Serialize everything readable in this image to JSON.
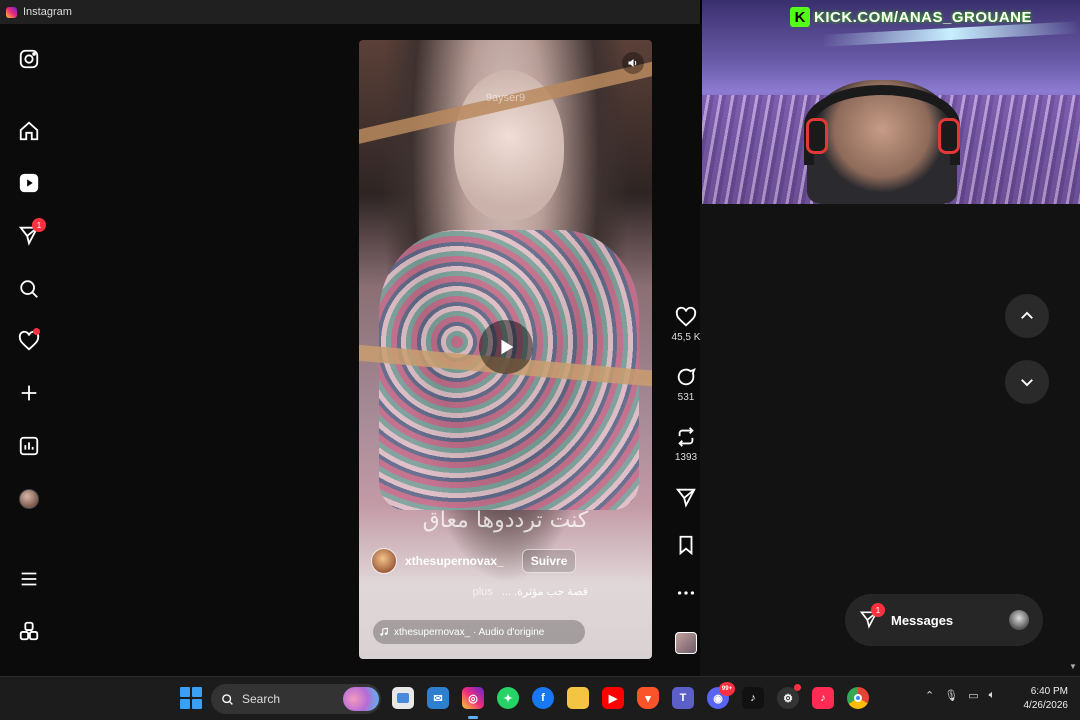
{
  "window": {
    "title": "Instagram"
  },
  "sidebar": {
    "items": [
      {
        "name": "instagram-logo",
        "icon": "instagram-icon"
      },
      {
        "name": "home",
        "icon": "home-icon"
      },
      {
        "name": "reels",
        "icon": "reels-icon"
      },
      {
        "name": "messages",
        "icon": "direct-icon",
        "badge": "1"
      },
      {
        "name": "search",
        "icon": "search-icon"
      },
      {
        "name": "notifications",
        "icon": "heart-icon"
      },
      {
        "name": "create",
        "icon": "plus-icon"
      },
      {
        "name": "dashboard",
        "icon": "chart-icon"
      },
      {
        "name": "profile",
        "icon": "avatar"
      },
      {
        "name": "more",
        "icon": "menu-icon"
      },
      {
        "name": "also-from-meta",
        "icon": "apps-icon"
      }
    ]
  },
  "reel": {
    "watermark": "9ayser9",
    "overlay_text": "كنت ترددوها معاق",
    "author": "xthesupernovax_",
    "follow_label": "Suivre",
    "caption": "قصة حب مؤثرة. ...",
    "more_label": "plus",
    "audio_label": "xthesupernovax_ · Audio d'origine"
  },
  "actions": {
    "likes": "45,5 K",
    "comments": "531",
    "reposts": "1393"
  },
  "messages": {
    "label": "Messages",
    "badge": "1"
  },
  "webcam": {
    "banner": "KICK.COM/ANAS_GROUANE",
    "banner_logo": "K"
  },
  "taskbar": {
    "search_placeholder": "Search",
    "time": "6:40 PM",
    "date": "4/26/2026",
    "discord_badge": "99+"
  },
  "colors": {
    "badge": "#ff3040",
    "kick_green": "#53fc18",
    "windows_blue": "#3aa0f5"
  }
}
